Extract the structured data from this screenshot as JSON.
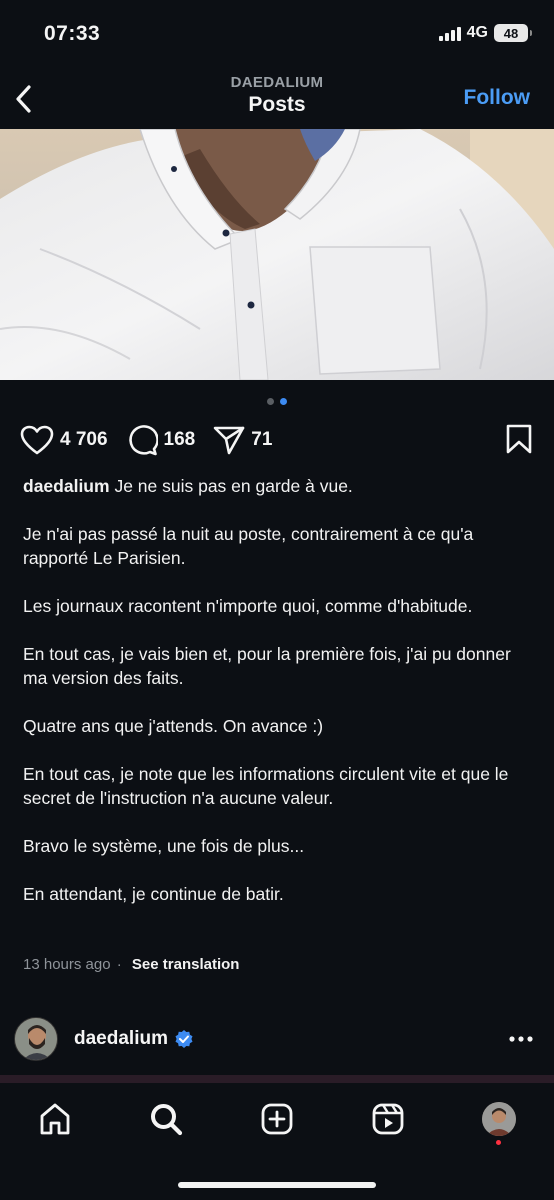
{
  "status_bar": {
    "time": "07:33",
    "network": "4G",
    "battery": "48"
  },
  "header": {
    "account": "DAEDALIUM",
    "title": "Posts",
    "follow_label": "Follow"
  },
  "carousel": {
    "count": 2,
    "active_index": 1
  },
  "actions": {
    "likes": "4 706",
    "comments": "168",
    "shares": "71"
  },
  "post": {
    "username": "daedalium",
    "caption_first": "Je ne suis pas en garde à vue.",
    "paragraphs": [
      "Je n'ai pas passé la nuit au poste, contrairement à ce qu'a rapporté Le Parisien.",
      "Les journaux racontent n'importe quoi, comme d'habitude.",
      "En tout cas, je vais bien et, pour la première fois, j'ai pu donner ma version des faits.",
      "Quatre ans que j'attends. On avance :)",
      "En tout cas, je note que les informations circulent vite et que le secret de l'instruction n'a aucune valeur.",
      "Bravo le système, une fois de plus...",
      "En attendant, je continue de batir."
    ],
    "time_ago": "13 hours ago",
    "separator": "·",
    "see_translation": "See translation"
  },
  "next_post": {
    "username": "daedalium",
    "verified": true
  },
  "tab_bar": {
    "items": [
      "home-icon",
      "search-icon",
      "create-icon",
      "reels-icon",
      "profile-avatar"
    ]
  },
  "colors": {
    "background": "#0c0f14",
    "accent": "#4b9cf5",
    "text": "#f2f2f2",
    "muted": "#8f949a",
    "notification": "#ff3040"
  }
}
